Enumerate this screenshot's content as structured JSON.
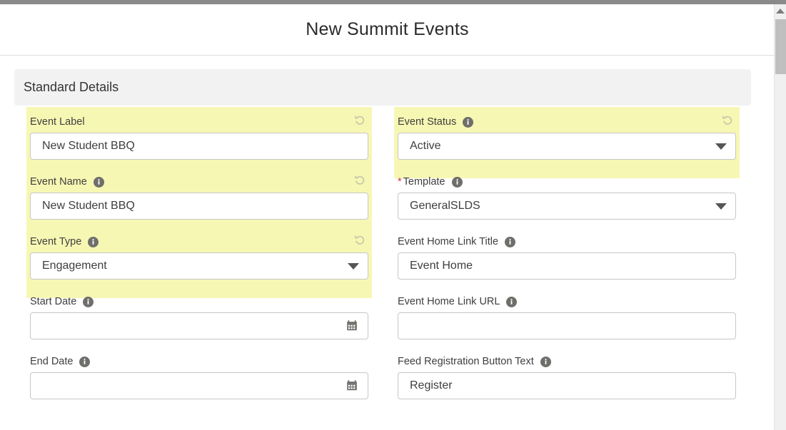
{
  "header": {
    "title": "New Summit Events"
  },
  "section": {
    "title": "Standard Details"
  },
  "icons": {
    "info": "info-icon",
    "revert": "revert-icon",
    "calendar": "calendar-icon",
    "dropdown": "chevron-down-icon",
    "scroll_up": "scroll-up-arrow-icon"
  },
  "colors": {
    "highlight": "#f7f7b4",
    "section_band": "#f2f2f2",
    "required_star": "#c23934",
    "border": "#c7c7c7",
    "text": "#3e3e3e",
    "icon_grey": "#706e6b"
  },
  "left_column": [
    {
      "label": "Event Label",
      "value": "New Student BBQ",
      "placeholder": "",
      "type": "text",
      "highlighted": true,
      "has_info": false,
      "has_revert": true,
      "required": false
    },
    {
      "label": "Event Name",
      "value": "New Student BBQ",
      "placeholder": "",
      "type": "text",
      "highlighted": true,
      "has_info": true,
      "has_revert": true,
      "required": false
    },
    {
      "label": "Event Type",
      "value": "Engagement",
      "placeholder": "",
      "type": "select",
      "highlighted": true,
      "has_info": true,
      "has_revert": true,
      "required": false
    },
    {
      "label": "Start Date",
      "value": "",
      "placeholder": "",
      "type": "date",
      "highlighted": false,
      "has_info": true,
      "has_revert": false,
      "required": false
    },
    {
      "label": "End Date",
      "value": "",
      "placeholder": "",
      "type": "date",
      "highlighted": false,
      "has_info": true,
      "has_revert": false,
      "required": false
    }
  ],
  "right_column": [
    {
      "label": "Event Status",
      "value": "Active",
      "placeholder": "",
      "type": "select",
      "highlighted": true,
      "has_info": true,
      "has_revert": true,
      "required": false
    },
    {
      "label": "Template",
      "value": "GeneralSLDS",
      "placeholder": "",
      "type": "select",
      "highlighted": false,
      "has_info": true,
      "has_revert": false,
      "required": true
    },
    {
      "label": "Event Home Link Title",
      "value": "Event Home",
      "placeholder": "",
      "type": "text",
      "highlighted": false,
      "has_info": true,
      "has_revert": false,
      "required": false
    },
    {
      "label": "Event Home Link URL",
      "value": "",
      "placeholder": "",
      "type": "text",
      "highlighted": false,
      "has_info": true,
      "has_revert": false,
      "required": false
    },
    {
      "label": "Feed Registration Button Text",
      "value": "Register",
      "placeholder": "",
      "type": "text",
      "highlighted": false,
      "has_info": true,
      "has_revert": false,
      "required": false
    }
  ]
}
